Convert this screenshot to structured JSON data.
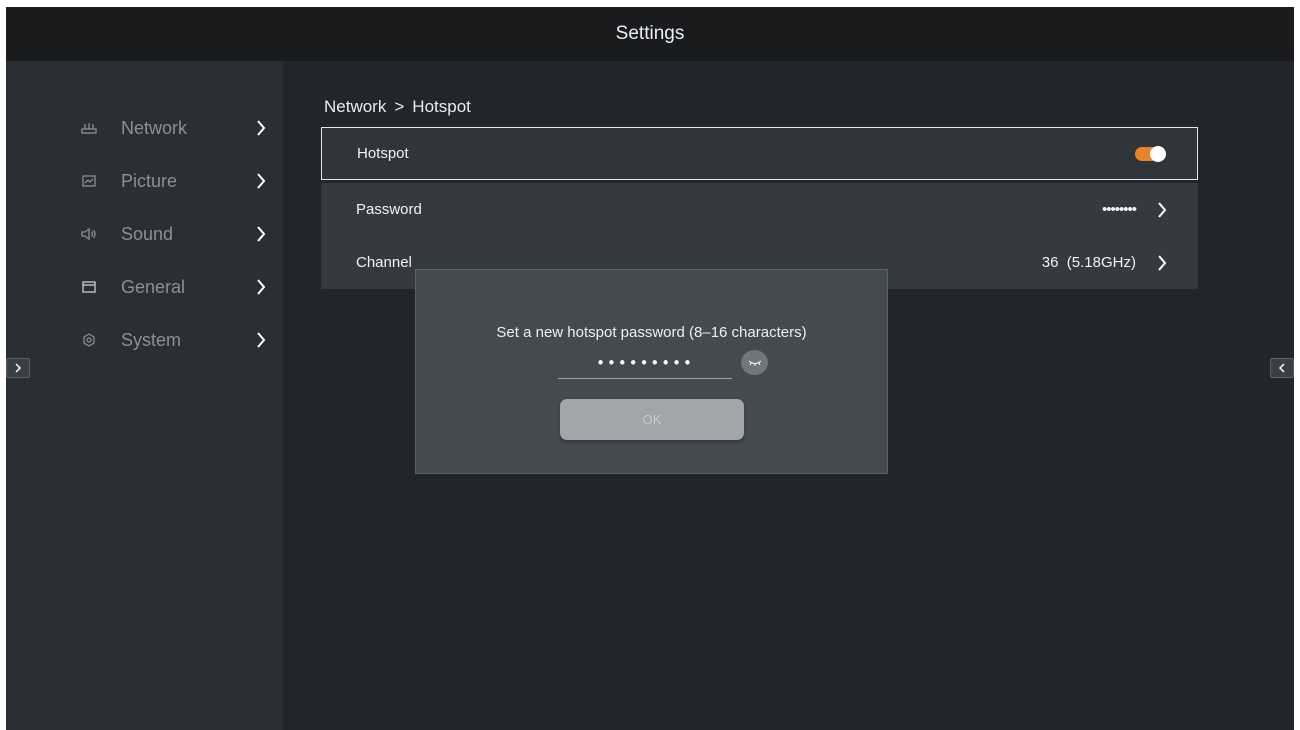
{
  "window": {
    "title": "Settings"
  },
  "sidebar": {
    "items": [
      {
        "label": "Network",
        "icon": "router-icon"
      },
      {
        "label": "Picture",
        "icon": "picture-icon"
      },
      {
        "label": "Sound",
        "icon": "speaker-icon"
      },
      {
        "label": "General",
        "icon": "window-icon"
      },
      {
        "label": "System",
        "icon": "gear-icon"
      }
    ]
  },
  "breadcrumb": {
    "parent": "Network",
    "separator": ">",
    "current": "Hotspot"
  },
  "settings": {
    "hotspot": {
      "label": "Hotspot",
      "enabled": true
    },
    "password": {
      "label": "Password",
      "value": "••••••••"
    },
    "channel": {
      "label": "Channel",
      "value": "36  (5.18GHz)"
    }
  },
  "dialog": {
    "title": "Set a new hotspot password (8–16 characters)",
    "password_value": "•••••••••",
    "ok_label": "OK"
  },
  "colors": {
    "accent": "#e8832f",
    "background": "#22262c",
    "sidebar": "#2b2f35",
    "row": "#353a41",
    "dialog": "#444a52"
  }
}
